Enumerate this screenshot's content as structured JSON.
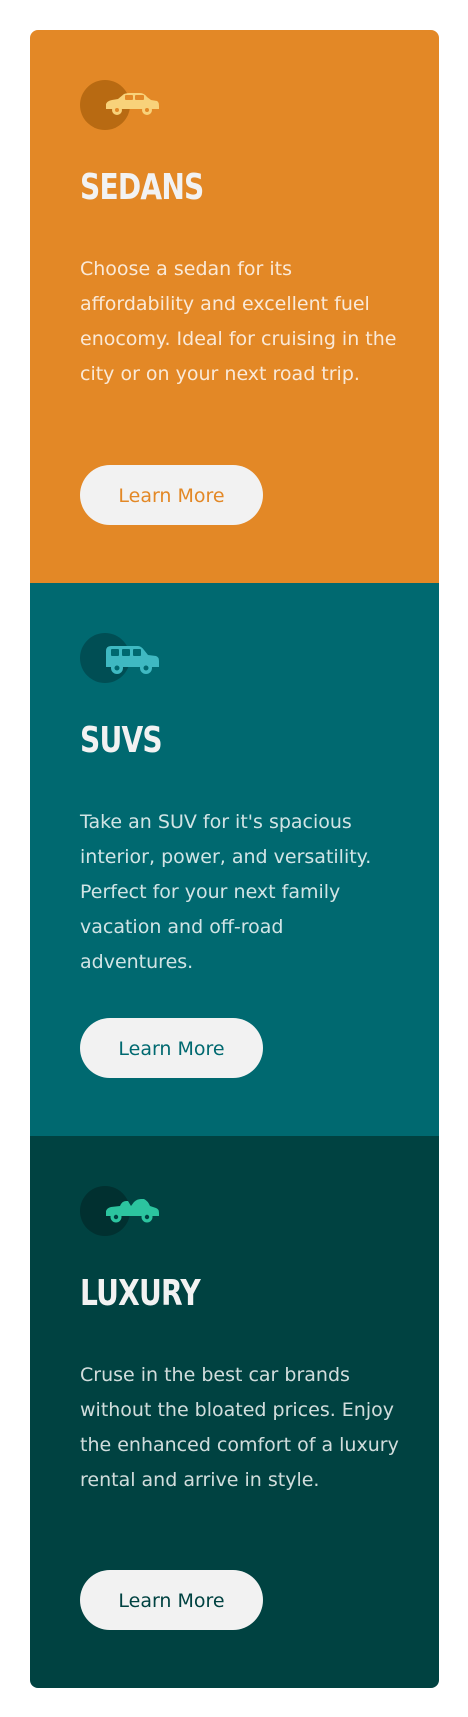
{
  "cards": [
    {
      "icon": "sedan-icon",
      "title": "SEDANS",
      "text": "Choose a sedan for its affordability and excellent fuel enocomy. Ideal for cruising in the city or on your next road trip.",
      "button_label": "Learn More",
      "bg_color": "#e38826",
      "accent_color": "#e38826",
      "icon_color": "#f8d27a",
      "icon_circle": "#b86a12"
    },
    {
      "icon": "suv-icon",
      "title": "SUVS",
      "text": "Take an SUV for it's spacious interior, power, and versatility. Perfect for your next family vacation and off-road adventures.",
      "button_label": "Learn More",
      "bg_color": "#006970",
      "accent_color": "#006970",
      "icon_color": "#3fb9c2",
      "icon_circle": "#004e54"
    },
    {
      "icon": "luxury-car-icon",
      "title": "LUXURY",
      "text": "Cruse in the best car brands without the bloated prices. Enjoy the enhanced comfort of a luxury rental and arrive in style.",
      "button_label": "Learn More",
      "bg_color": "#004241",
      "accent_color": "#004241",
      "icon_color": "#2cc49f",
      "icon_circle": "#013030"
    }
  ]
}
